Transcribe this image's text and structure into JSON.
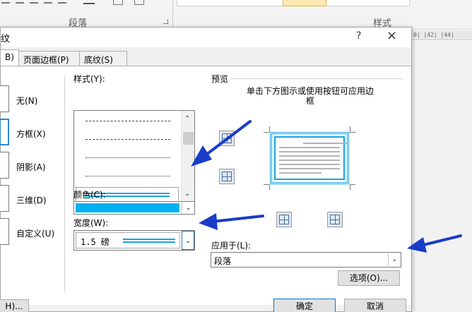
{
  "ribbon": {
    "group_paragraph": "段落",
    "group_styles": "样式"
  },
  "ruler": {
    "text": "0|  |42|  |44|"
  },
  "dialog": {
    "title": "纹",
    "help": "?",
    "close": "×",
    "tabs": [
      {
        "label": "B)",
        "active": true
      },
      {
        "label": "页面边框(P)",
        "active": false
      },
      {
        "label": "底纹(S)",
        "active": false
      }
    ],
    "settings": [
      {
        "label": "无(N)",
        "selected": false
      },
      {
        "label": "方框(X)",
        "selected": true
      },
      {
        "label": "阴影(A)",
        "selected": false
      },
      {
        "label": "三维(D)",
        "selected": false
      },
      {
        "label": "自定义(U)",
        "selected": false
      }
    ],
    "style_label": "样式(Y):",
    "color_label": "颜色(C):",
    "color_value": "#00b0f0",
    "width_label": "宽度(W):",
    "width_value": "1.5 磅",
    "preview_label": "预览",
    "preview_hint": "单击下方图示或使用按钮可应用边框",
    "apply_label": "应用于(L):",
    "apply_value": "段落",
    "options_button": "选项(O)...",
    "ok_button": "确定",
    "cancel_button": "取消",
    "bottom_left_button": "H)...",
    "annotation_color": "#1a3cc8"
  }
}
